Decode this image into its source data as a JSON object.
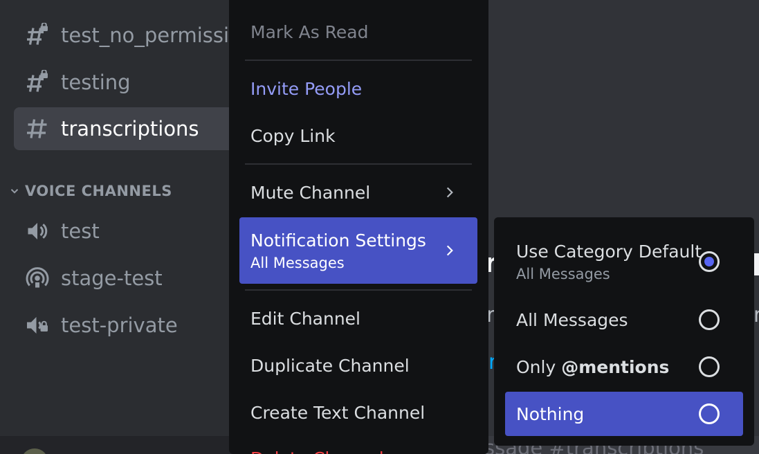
{
  "sidebar": {
    "text_channels": [
      {
        "label": "test_no_permissions",
        "icon": "hashtag-lock-icon"
      },
      {
        "label": "testing",
        "icon": "hashtag-lock-icon"
      },
      {
        "label": "transcriptions",
        "icon": "hashtag-icon",
        "active": true
      }
    ],
    "voice_category": "VOICE CHANNELS",
    "voice_channels": [
      {
        "label": "test",
        "icon": "speaker-icon"
      },
      {
        "label": "stage-test",
        "icon": "stage-icon"
      },
      {
        "label": "test-private",
        "icon": "speaker-lock-icon"
      }
    ]
  },
  "main": {
    "fragment_1": "n",
    "fragment_2": "r",
    "fragment_3": "r",
    "fragment_4": "r",
    "composer_placeholder": "ssage #transcriptions"
  },
  "context_menu": {
    "mark_as_read": "Mark As Read",
    "invite_people": "Invite People",
    "copy_link": "Copy Link",
    "mute_channel": "Mute Channel",
    "notification_settings": "Notification Settings",
    "notification_settings_value": "All Messages",
    "edit_channel": "Edit Channel",
    "duplicate_channel": "Duplicate Channel",
    "create_text_channel": "Create Text Channel",
    "delete_channel": "Delete Channel"
  },
  "notification_submenu": {
    "use_category_default": "Use Category Default",
    "use_category_default_value": "All Messages",
    "all_messages": "All Messages",
    "only_prefix": "Only",
    "mentions": "@mentions",
    "nothing": "Nothing",
    "checked_option": "use_category_default"
  },
  "colors": {
    "accent": "#4752c4",
    "radio_checked": "#5865f2",
    "invite": "#949cf7",
    "danger": "#f23f43"
  }
}
